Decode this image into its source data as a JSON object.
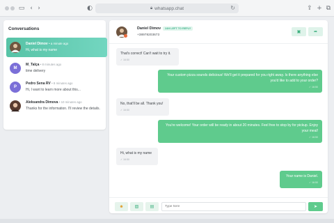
{
  "browser": {
    "url": "whatsapp.chat"
  },
  "sidebar": {
    "title": "Conversations",
    "items": [
      {
        "name": "Daniel Dimov",
        "time": "• a minute ago",
        "message": "Hi, what is my name",
        "initial": "",
        "color": "#8a6a4f"
      },
      {
        "name": "M_Talça",
        "time": "• 8 minutes ago",
        "message": "time delivery",
        "initial": "M",
        "color": "#7b6fd8"
      },
      {
        "name": "Pedro Sena RV",
        "time": "• 8 minutes ago",
        "message": "Hi, I want to learn more about this...",
        "initial": "P",
        "color": "#7b6fd8"
      },
      {
        "name": "Aleksandra Dimova",
        "time": "• 10 minutes ago",
        "message": "Thanks for the information. I'll review the details.",
        "initial": "",
        "color": "#8a5a4a"
      }
    ]
  },
  "chat": {
    "contact_name": "Daniel Dimov",
    "badge": "24H LEFT TO REPLY",
    "phone": "+38978203673",
    "messages": [
      {
        "dir": "in",
        "text": "That's correct! Can't wait to try it.",
        "time": "✓ 16:50"
      },
      {
        "dir": "out",
        "text": "Your custom pizza sounds delicious! We'll get it prepared for you right away. Is there anything else you'd like to add to your order?",
        "time": "✓ 16:50"
      },
      {
        "dir": "in",
        "text": "No, that'll be all. Thank you!",
        "time": "✓ 16:50"
      },
      {
        "dir": "out",
        "text": "You're welcome! Your order will be ready in about 20 minutes. Feel free to stop by for pickup. Enjoy your meal!",
        "time": "✓ 16:50"
      },
      {
        "dir": "in",
        "text": "Hi, what is my name",
        "time": "✓ 16:50"
      },
      {
        "dir": "out",
        "text": "Your name is Daniel.",
        "time": "✓ 16:50"
      }
    ],
    "input_placeholder": "Type here"
  },
  "colors": {
    "accent": "#5fcb8d",
    "active_gradient_start": "#57c3a6"
  },
  "icons": [
    "sidebar-toggle-icon",
    "back-icon",
    "forward-icon",
    "shield-icon",
    "lock-icon",
    "reload-icon",
    "share-icon",
    "new-tab-icon",
    "tabs-icon",
    "copy-icon",
    "forward-arrow-icon",
    "emoji-icon",
    "image-icon",
    "document-icon",
    "send-icon"
  ]
}
